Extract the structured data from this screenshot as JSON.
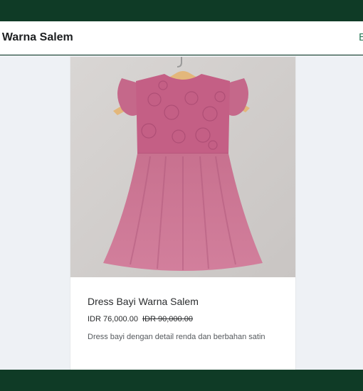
{
  "header": {
    "title": "i Warna Salem",
    "right_link": "E"
  },
  "product": {
    "title": "Dress Bayi Warna Salem",
    "price": "IDR 76,000.00",
    "original_price": "IDR 90,000.00",
    "description": "Dress bayi dengan detail renda dan berbahan satin",
    "image_icon": "pink-baby-dress-photo"
  },
  "colors": {
    "dark_band": "#0f3b26",
    "accent": "#2e7d5b",
    "dress_pink": "#c97394",
    "page_bg": "#eef1f5"
  }
}
